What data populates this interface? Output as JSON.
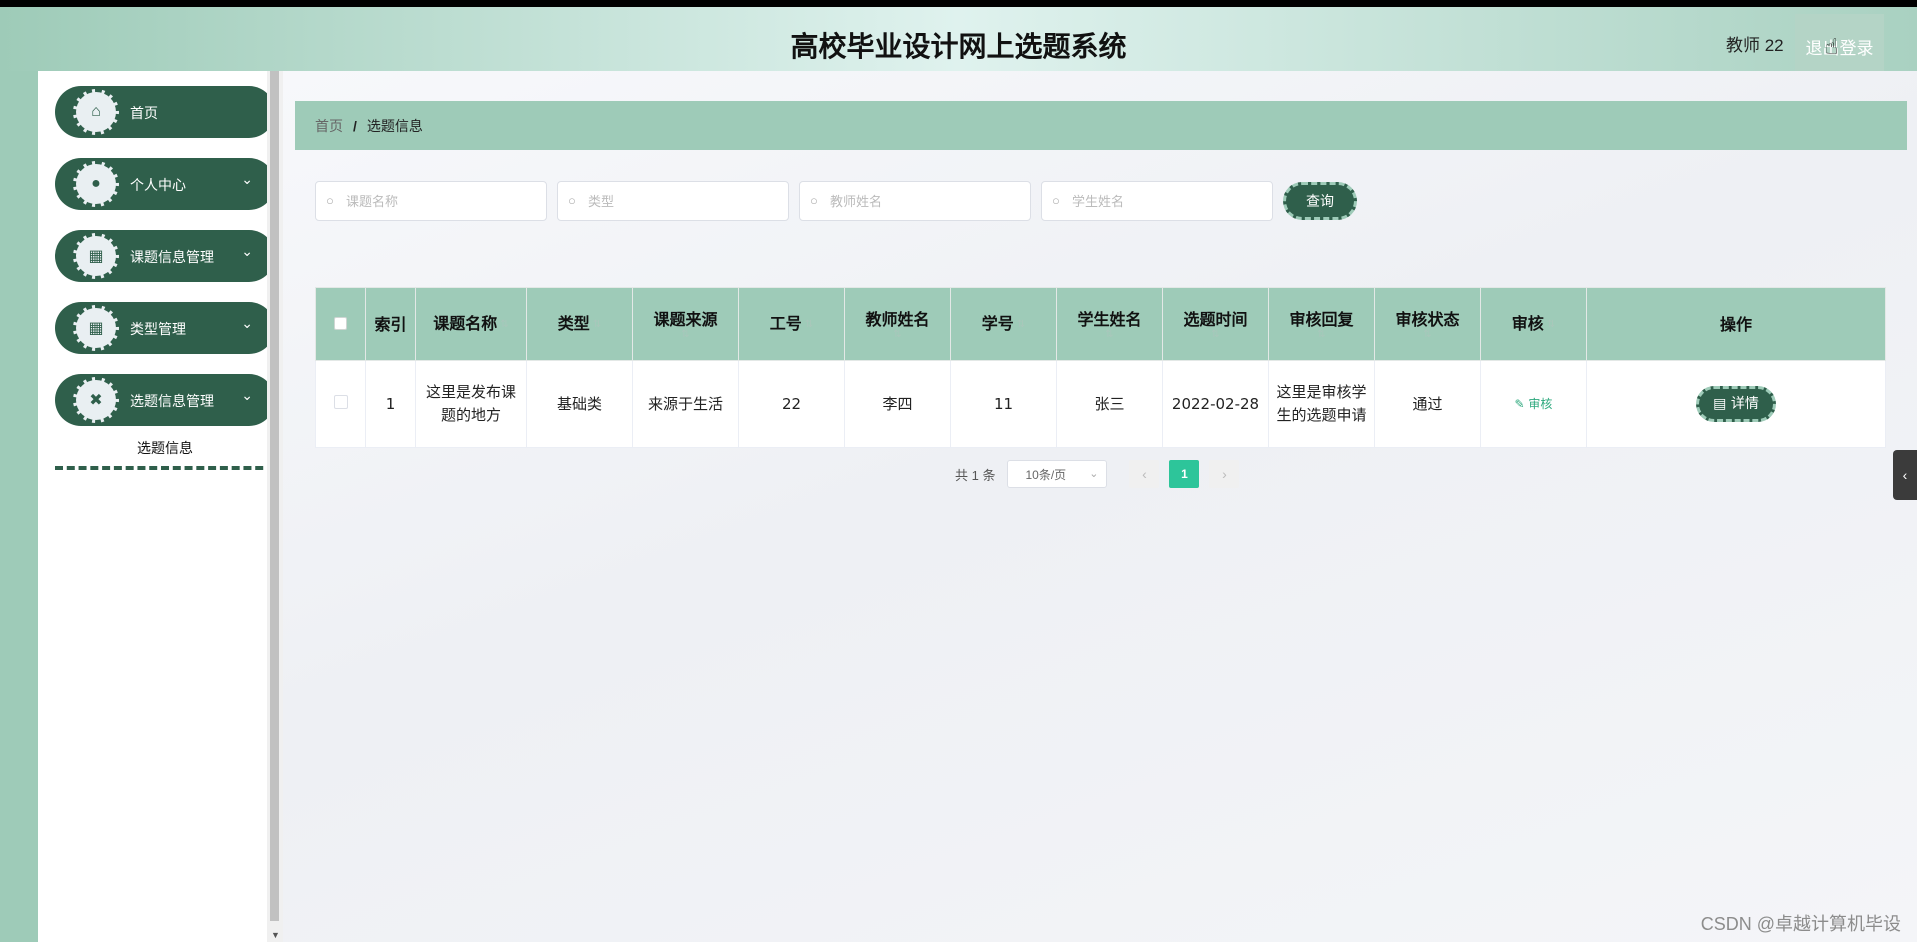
{
  "header": {
    "title": "高校毕业设计网上选题系统",
    "user": "教师 22",
    "logout": "退出登录"
  },
  "sidebar": {
    "items": [
      {
        "label": "首页",
        "icon": "home-icon",
        "has_children": false
      },
      {
        "label": "个人中心",
        "icon": "user-icon",
        "has_children": true
      },
      {
        "label": "课题信息管理",
        "icon": "grid-icon",
        "has_children": true
      },
      {
        "label": "类型管理",
        "icon": "grid-icon",
        "has_children": true
      },
      {
        "label": "选题信息管理",
        "icon": "selection-icon",
        "has_children": true
      }
    ],
    "sub_item": "选题信息"
  },
  "breadcrumb": {
    "home": "首页",
    "separator": "/",
    "current": "选题信息"
  },
  "search": {
    "placeholders": [
      "课题名称",
      "类型",
      "教师姓名",
      "学生姓名"
    ],
    "button": "查询"
  },
  "table": {
    "headers": [
      "索引",
      "课题名称",
      "类型",
      "课题来源",
      "工号",
      "教师姓名",
      "学号",
      "学生姓名",
      "选题时间",
      "审核回复",
      "审核状态",
      "审核",
      "操作"
    ],
    "rows": [
      {
        "index": "1",
        "topic": "这里是发布课题的地方",
        "type": "基础类",
        "source": "来源于生活",
        "teacher_no": "22",
        "teacher_name": "李四",
        "student_no": "11",
        "student_name": "张三",
        "time": "2022-02-28",
        "reply": "这里是审核学生的选题申请",
        "status": "通过",
        "review": "审核",
        "action": "详情"
      }
    ]
  },
  "pagination": {
    "total": "共 1 条",
    "page_size": "10条/页",
    "current_page": "1"
  },
  "watermark": "CSDN @卓越计算机毕设",
  "colors": {
    "primary": "#2f5f4b",
    "accent": "#9ecbb8",
    "page_active": "#2dc59a"
  }
}
